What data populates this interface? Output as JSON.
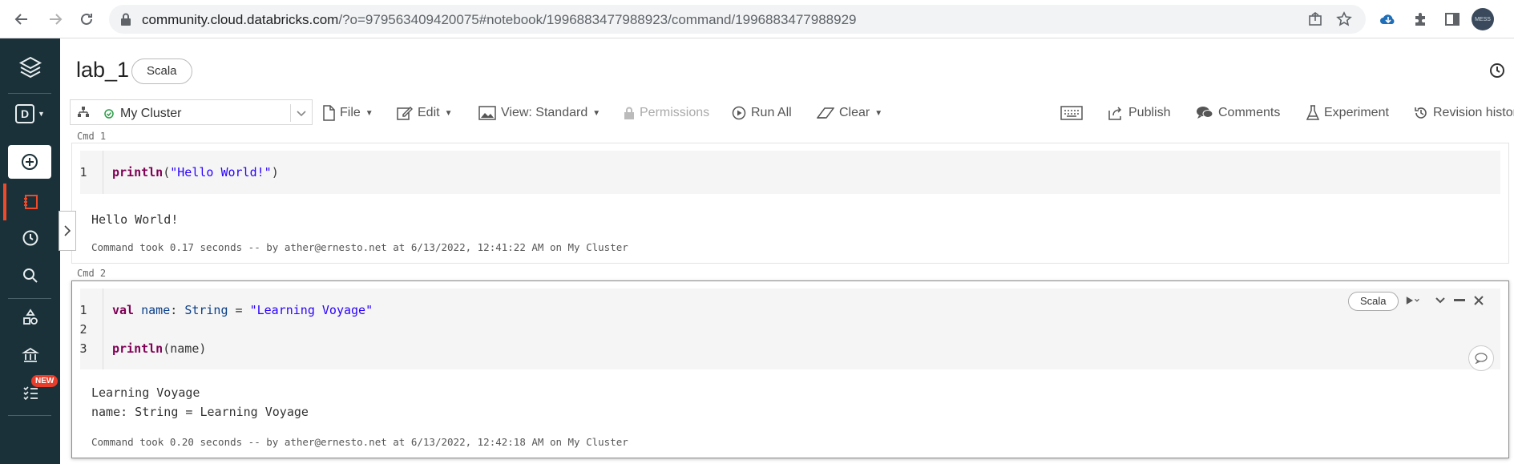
{
  "browser": {
    "url_host": "community.cloud.databricks.com",
    "url_path": "/?o=979563409420075#notebook/1996883477988923/command/1996883477988929"
  },
  "rail": {
    "workspace_badge": "D",
    "new_badge": "NEW"
  },
  "notebook": {
    "title": "lab_1",
    "language": "Scala"
  },
  "toolbar": {
    "cluster": "My Cluster",
    "file": "File",
    "edit": "Edit",
    "view": "View: Standard",
    "permissions": "Permissions",
    "run_all": "Run All",
    "clear": "Clear",
    "publish": "Publish",
    "comments": "Comments",
    "experiment": "Experiment",
    "revision_history": "Revision history"
  },
  "cells": [
    {
      "label": "Cmd 1",
      "line_numbers": [
        "1"
      ],
      "output": [
        "Hello World!"
      ],
      "info": "Command took 0.17 seconds -- by ather@ernesto.net at 6/13/2022, 12:41:22 AM on My Cluster"
    },
    {
      "label": "Cmd 2",
      "language": "Scala",
      "line_numbers": [
        "1",
        "2",
        "3"
      ],
      "output": [
        "Learning Voyage",
        "name: String = Learning Voyage"
      ],
      "info": "Command took 0.20 seconds -- by ather@ernesto.net at 6/13/2022, 12:42:18 AM on My Cluster"
    }
  ],
  "code_tokens": {
    "c1_fn": "println",
    "c1_open": "(",
    "c1_str": "\"Hello World!\"",
    "c1_close": ")",
    "c2_val": "val",
    "c2_name": "name",
    "c2_colon": ": ",
    "c2_type": "String",
    "c2_eq": " = ",
    "c2_str": "\"Learning Voyage\"",
    "c2_fn": "println",
    "c2_arg": "(name)"
  },
  "profile_text": "MESS"
}
